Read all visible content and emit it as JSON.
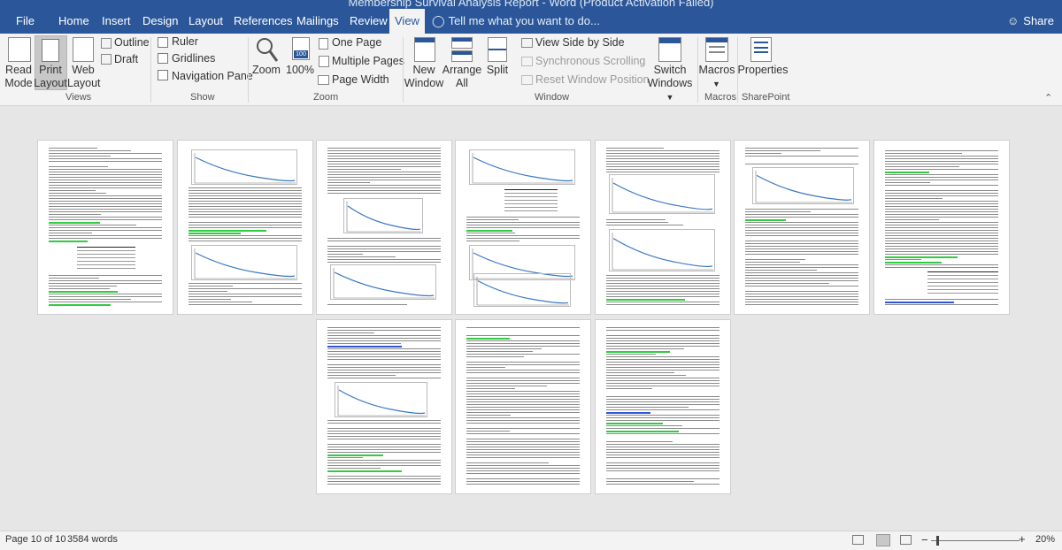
{
  "window": {
    "title": "Membership Survival Analysis Report - Word (Product Activation Failed)"
  },
  "menu": {
    "tabs": [
      "File",
      "Home",
      "Insert",
      "Design",
      "Layout",
      "References",
      "Mailings",
      "Review",
      "View"
    ],
    "active_tab": "View",
    "tell_me": "Tell me what you want to do...",
    "share": "Share"
  },
  "ribbon": {
    "views": {
      "read_mode": [
        "Read",
        "Mode"
      ],
      "print_layout": [
        "Print",
        "Layout"
      ],
      "web_layout": [
        "Web",
        "Layout"
      ],
      "outline": "Outline",
      "draft": "Draft",
      "group": "Views"
    },
    "show": {
      "ruler": "Ruler",
      "gridlines": "Gridlines",
      "navigation_pane": "Navigation Pane",
      "group": "Show"
    },
    "zoom": {
      "zoom": "Zoom",
      "percent_100": "100%",
      "icon_text": "100",
      "one_page": "One Page",
      "multiple_pages": "Multiple Pages",
      "page_width": "Page Width",
      "group": "Zoom"
    },
    "window": {
      "new_window": [
        "New",
        "Window"
      ],
      "arrange_all": [
        "Arrange",
        "All"
      ],
      "split": "Split",
      "view_side_by_side": "View Side by Side",
      "synchronous_scrolling": "Synchronous Scrolling",
      "reset_window_position": "Reset Window Position",
      "switch_windows": [
        "Switch",
        "Windows"
      ],
      "group": "Window"
    },
    "macros": {
      "macros": "Macros",
      "group": "Macros"
    },
    "sharepoint": {
      "properties": "Properties",
      "group": "SharePoint"
    }
  },
  "status": {
    "page": "Page 10 of 10",
    "words": "3584 words",
    "zoom": "20%"
  }
}
